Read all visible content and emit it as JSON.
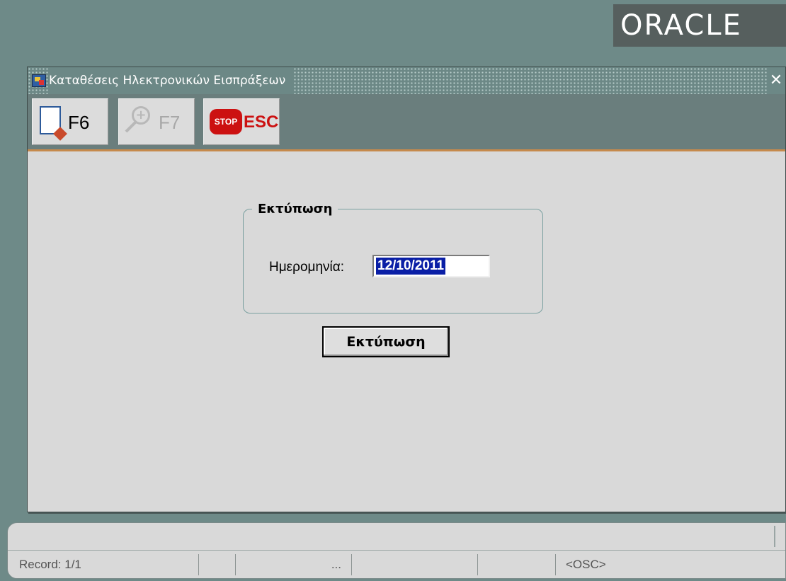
{
  "logo": {
    "text": "ORACLE"
  },
  "window": {
    "title": "Καταθέσεις Ηλεκτρονικών Εισπράξεων",
    "close_symbol": "✕",
    "title_icon": "form-app-icon"
  },
  "toolbar": {
    "buttons": [
      {
        "label": "F6",
        "icon": "new-document-icon",
        "enabled": true
      },
      {
        "label": "F7",
        "icon": "zoom-in-icon",
        "enabled": false
      },
      {
        "label": "ESC",
        "icon": "stop-sign-icon",
        "icon_text": "STOP",
        "enabled": true
      }
    ]
  },
  "print_group": {
    "legend": "Εκτύπωση",
    "date_label": "Ημερομηνία:",
    "date_value": "12/10/2011",
    "date_selected": true
  },
  "print_button": {
    "label": "Εκτύπωση"
  },
  "status": {
    "record": "Record: 1/1",
    "ellipsis": "...",
    "mode": "<OSC>"
  },
  "colors": {
    "desktop": "#6e8a88",
    "accent_line": "#c68a4c",
    "selection": "#0a1fa6",
    "stop_red": "#cc1111"
  }
}
